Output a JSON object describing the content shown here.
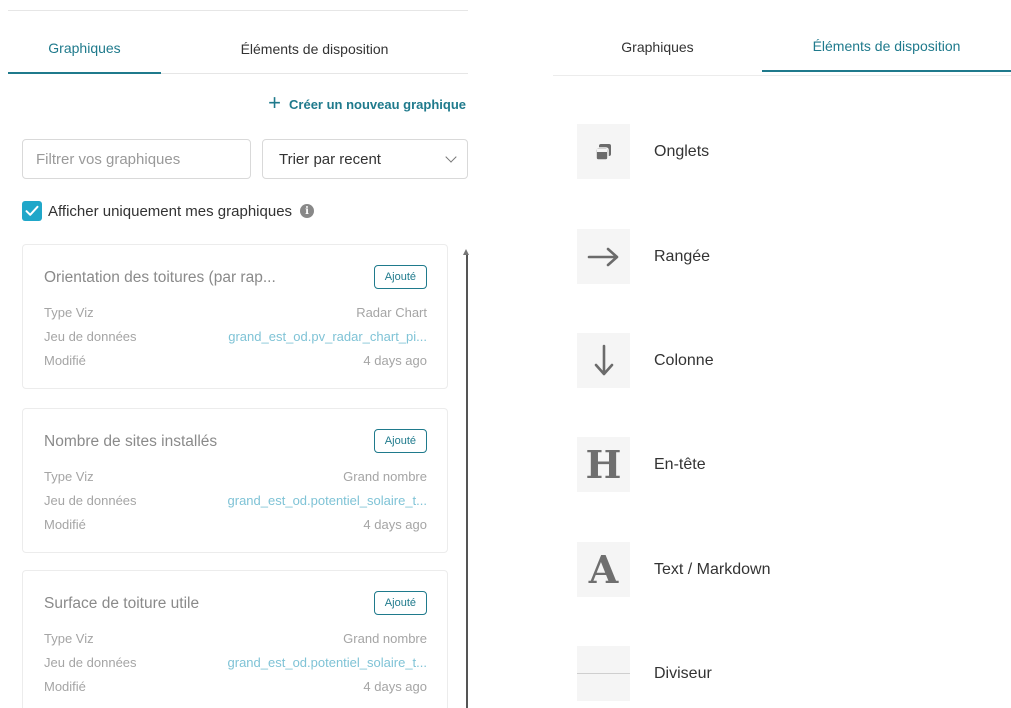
{
  "left": {
    "tabs": [
      {
        "label": "Graphiques",
        "active": true
      },
      {
        "label": "Éléments de disposition",
        "active": false
      }
    ],
    "create_link": "Créer un nouveau graphique",
    "filter": {
      "placeholder": "Filtrer vos graphiques",
      "value": ""
    },
    "sort": {
      "value": "Trier par recent"
    },
    "only_mine": {
      "label": "Afficher uniquement mes graphiques",
      "checked": true
    },
    "cards": [
      {
        "title": "Orientation des toitures (par rap...",
        "badge": "Ajouté",
        "type_label": "Type Viz",
        "type_value": "Radar Chart",
        "dataset_label": "Jeu de données",
        "dataset_value": "grand_est_od.pv_radar_chart_pi...",
        "modified_label": "Modifié",
        "modified_value": "4 days ago"
      },
      {
        "title": "Nombre de sites installés",
        "badge": "Ajouté",
        "type_label": "Type Viz",
        "type_value": "Grand nombre",
        "dataset_label": "Jeu de données",
        "dataset_value": "grand_est_od.potentiel_solaire_t...",
        "modified_label": "Modifié",
        "modified_value": "4 days ago"
      },
      {
        "title": "Surface de toiture utile",
        "badge": "Ajouté",
        "type_label": "Type Viz",
        "type_value": "Grand nombre",
        "dataset_label": "Jeu de données",
        "dataset_value": "grand_est_od.potentiel_solaire_t...",
        "modified_label": "Modifié",
        "modified_value": "4 days ago"
      }
    ]
  },
  "right": {
    "tabs": [
      {
        "label": "Graphiques",
        "active": false
      },
      {
        "label": "Éléments de disposition",
        "active": true
      }
    ],
    "items": [
      {
        "label": "Onglets",
        "icon": "tabs-icon"
      },
      {
        "label": "Rangée",
        "icon": "arrow-right-icon"
      },
      {
        "label": "Colonne",
        "icon": "arrow-down-icon"
      },
      {
        "label": "En-tête",
        "icon": "header-icon",
        "glyph": "H"
      },
      {
        "label": "Text / Markdown",
        "icon": "text-markdown-icon",
        "glyph": "A"
      },
      {
        "label": "Diviseur",
        "icon": "divider-icon"
      }
    ]
  },
  "colors": {
    "accent": "#1f7a8c",
    "checkbox": "#20a7c9",
    "dataset_link": "#7fc3d6"
  }
}
